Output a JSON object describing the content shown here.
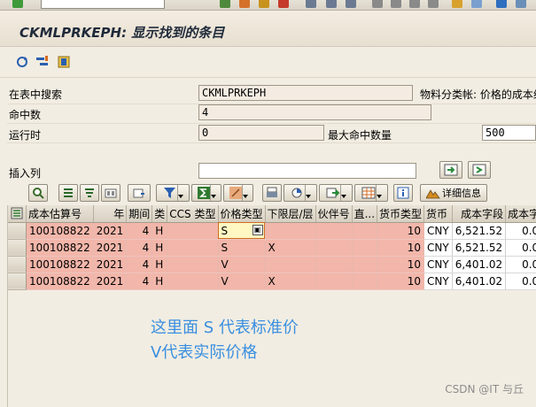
{
  "title": "CKMLPRKEPH: 显示找到的条目",
  "form": {
    "search_in_table_label": "在表中搜索",
    "search_in_table_value": "CKMLPRKEPH",
    "material_ledger_text": "物料分类帐: 价格的成本组",
    "hits_label": "命中数",
    "hits_value": "4",
    "runtime_label": "运行时",
    "runtime_value": "0",
    "max_hits_label": "最大命中数量",
    "max_hits_value": "500",
    "insert_col_label": "插入列",
    "insert_col_value": ""
  },
  "alv_toolbar": {
    "details_label": "详细信息"
  },
  "table": {
    "columns": [
      "成本估算号",
      "年",
      "期间",
      "类",
      "CCS 类型",
      "价格类型",
      "下限层/层",
      "伙伴号",
      "直...",
      "货币类型",
      "货币",
      "成本字段",
      "成本字"
    ],
    "rows": [
      [
        "100108822",
        "2021",
        "4",
        "H",
        "",
        "S",
        "",
        "",
        "",
        "10",
        "CNY",
        "6,521.52",
        "0.0"
      ],
      [
        "100108822",
        "2021",
        "4",
        "H",
        "",
        "S",
        "X",
        "",
        "",
        "10",
        "CNY",
        "6,521.52",
        "0.0"
      ],
      [
        "100108822",
        "2021",
        "4",
        "H",
        "",
        "V",
        "",
        "",
        "",
        "10",
        "CNY",
        "6,401.02",
        "0.0"
      ],
      [
        "100108822",
        "2021",
        "4",
        "H",
        "",
        "V",
        "X",
        "",
        "",
        "10",
        "CNY",
        "6,401.02",
        "0.0"
      ]
    ]
  },
  "annotation": {
    "line1": "这里面 S 代表标准价",
    "line2": "V代表实际价格"
  },
  "watermark": "CSDN @IT 与丘"
}
